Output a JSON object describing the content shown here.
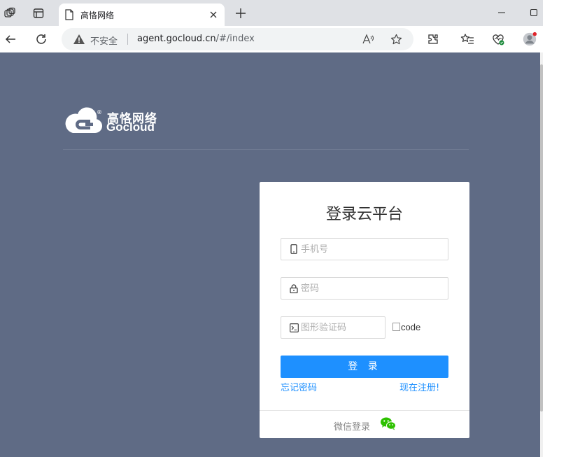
{
  "browser": {
    "tab_title": "高恪网络",
    "security_label": "不安全",
    "url_host": "agent.gocloud.cn",
    "url_path": "/#/index"
  },
  "brand": {
    "name_cn": "高恪网络",
    "name_en": "Gocloud",
    "registered_mark": "®"
  },
  "login": {
    "title": "登录云平台",
    "phone_placeholder": "手机号",
    "password_placeholder": "密码",
    "captcha_placeholder": "图形验证码",
    "captcha_image_alt": "code",
    "submit_label": "登 录",
    "forgot_label": "忘记密码",
    "register_label": "现在注册!",
    "wechat_label": "微信登录"
  },
  "colors": {
    "page_bg": "#5f6b85",
    "primary": "#1e90ff",
    "wechat": "#2dc100"
  }
}
